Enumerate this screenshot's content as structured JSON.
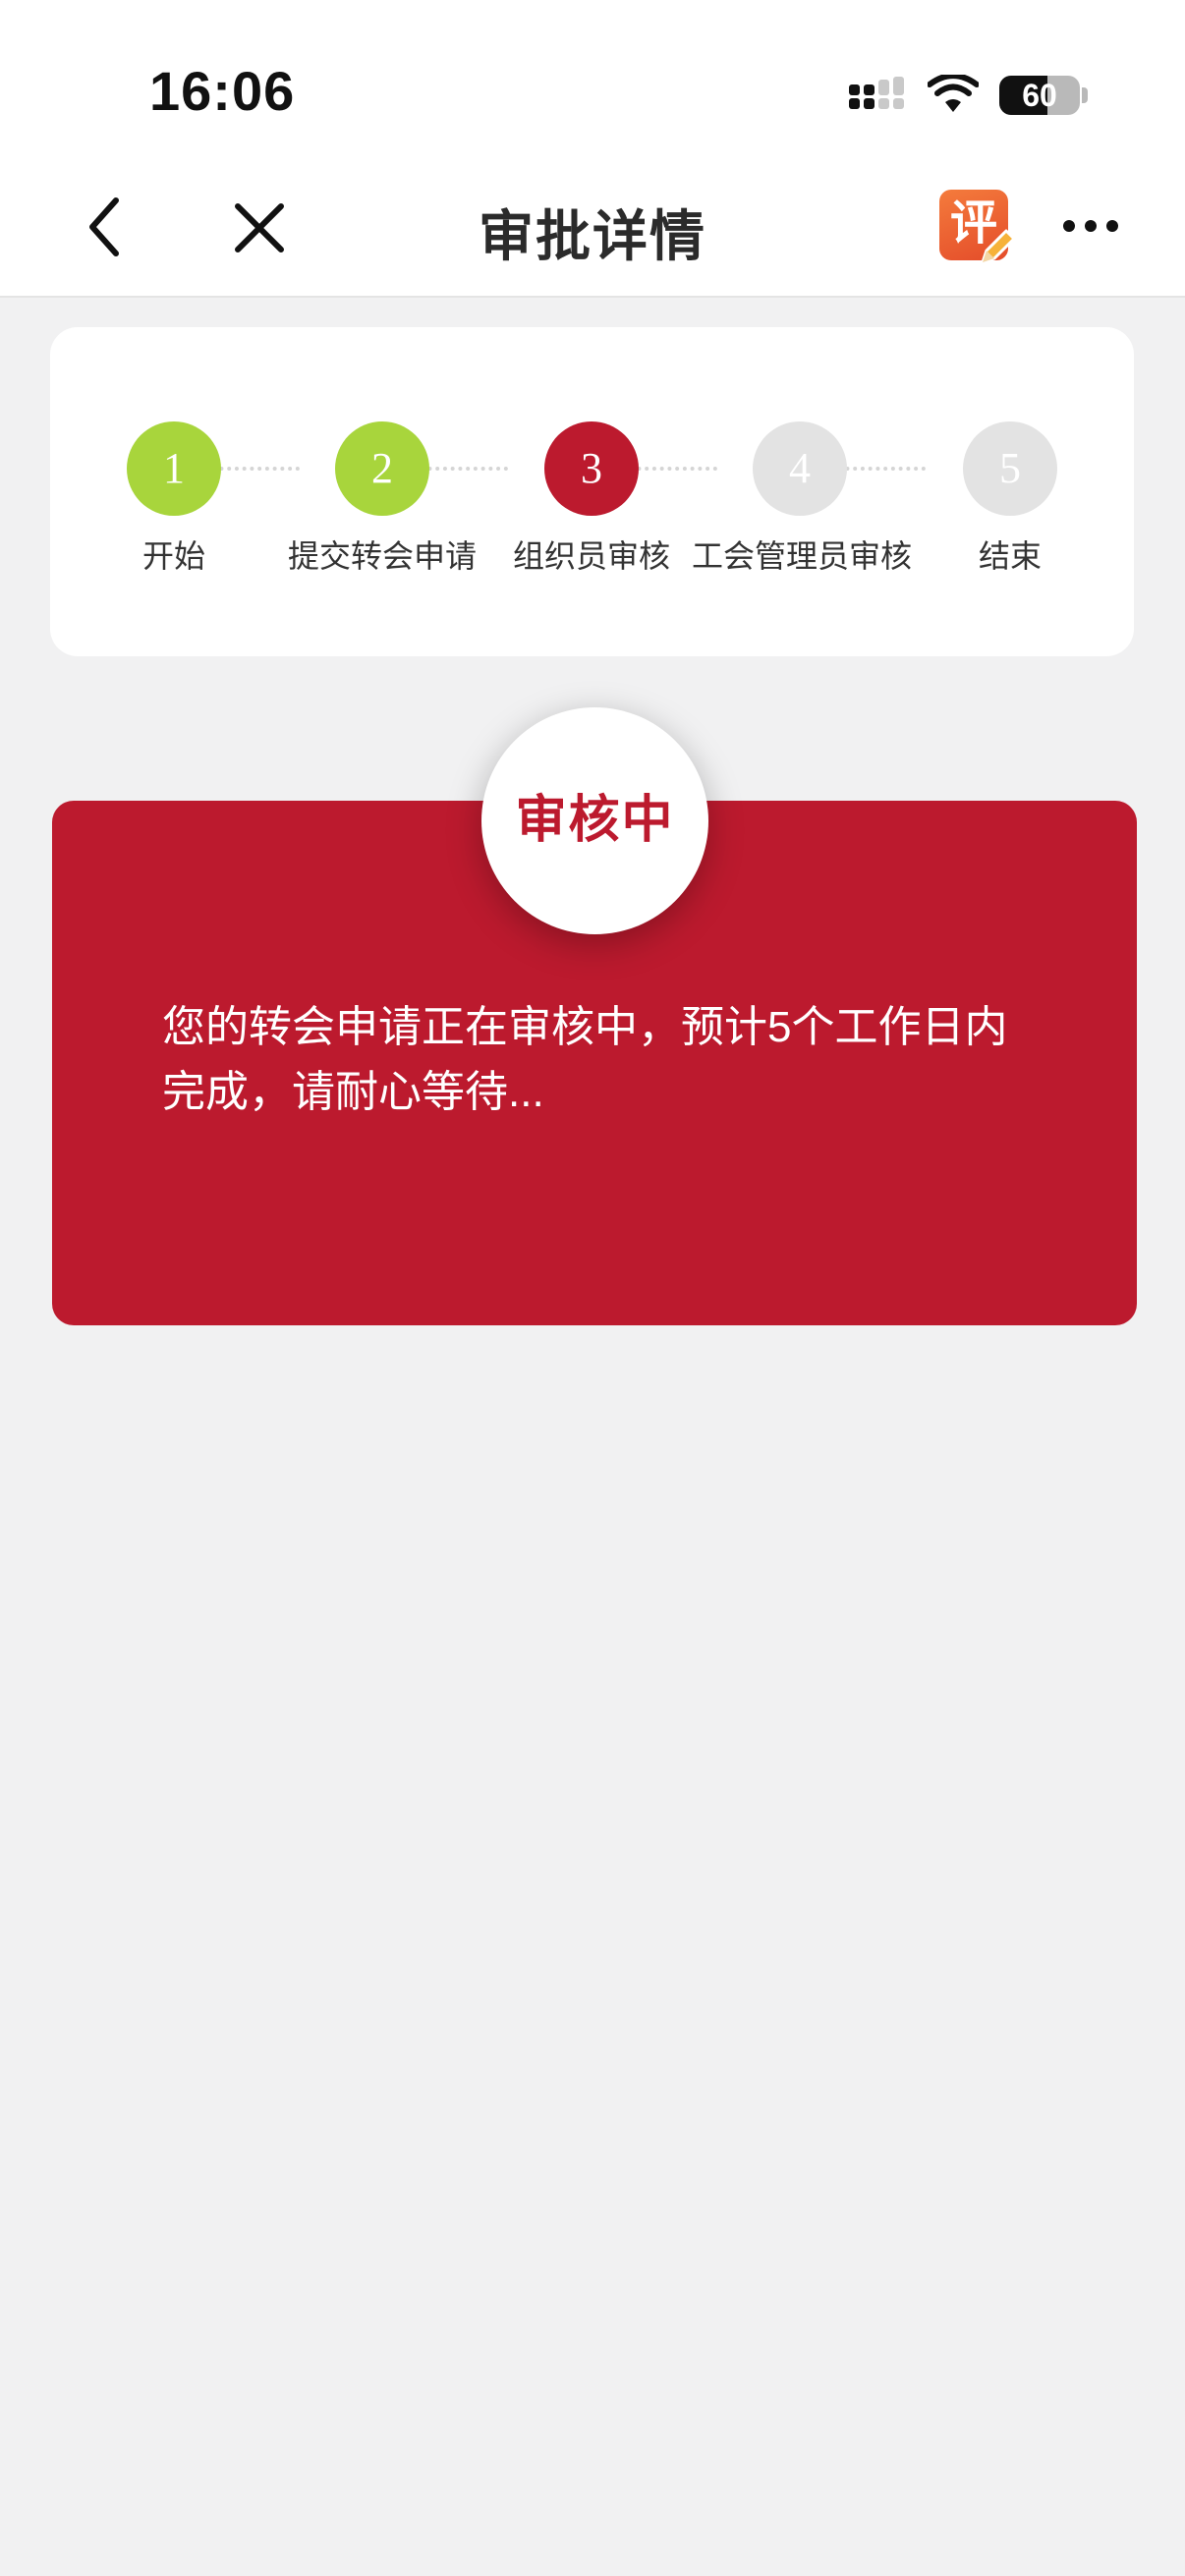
{
  "status_bar": {
    "time": "16:06",
    "battery": "60",
    "battery_level": 0.6,
    "icons": [
      "cellular-signal-icon",
      "wifi-icon",
      "battery-icon"
    ]
  },
  "header": {
    "title": "审批详情",
    "back_icon": "chevron-left-icon",
    "close_icon": "close-icon",
    "review_badge": "评",
    "review_badge_icon": "pencil-icon",
    "more_icon": "more-dots-icon"
  },
  "steps": [
    {
      "number": "1",
      "label": "开始",
      "state": "done"
    },
    {
      "number": "2",
      "label": "提交转会申请",
      "state": "done"
    },
    {
      "number": "3",
      "label": "组织员审核",
      "state": "current"
    },
    {
      "number": "4",
      "label": "工会管理员审核",
      "state": "pending"
    },
    {
      "number": "5",
      "label": "结束",
      "state": "pending"
    }
  ],
  "status_card": {
    "badge": "审核中",
    "message": "您的转会申请正在审核中，预计5个工作日内完成，请耐心等待..."
  },
  "colors": {
    "accent_red": "#bc1a2e",
    "done_green": "#a8d53c",
    "pending_gray": "#e3e3e3",
    "page_bg": "#f1f1f2",
    "badge_orange": "#ef6a33"
  }
}
